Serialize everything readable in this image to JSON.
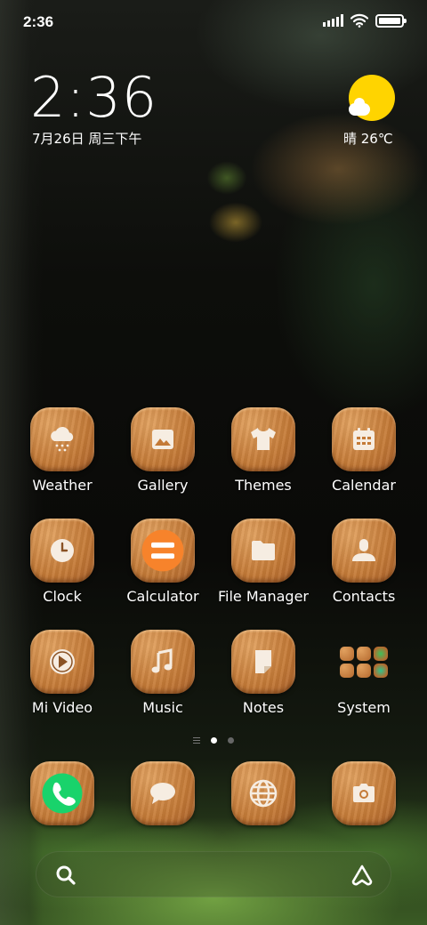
{
  "status_bar": {
    "time": "2:36"
  },
  "clock_widget": {
    "time": "2:36",
    "date": "7月26日 周三下午",
    "weather": "晴 26℃"
  },
  "apps": [
    {
      "label": "Weather",
      "icon": "weather-snow-cloud-icon"
    },
    {
      "label": "Gallery",
      "icon": "gallery-image-icon"
    },
    {
      "label": "Themes",
      "icon": "tshirt-icon"
    },
    {
      "label": "Calendar",
      "icon": "calendar-icon"
    },
    {
      "label": "Clock",
      "icon": "clock-icon"
    },
    {
      "label": "Calculator",
      "icon": "calculator-equals-icon"
    },
    {
      "label": "File Manager",
      "icon": "folder-icon"
    },
    {
      "label": "Contacts",
      "icon": "person-icon"
    },
    {
      "label": "Mi Video",
      "icon": "play-icon"
    },
    {
      "label": "Music",
      "icon": "music-note-icon"
    },
    {
      "label": "Notes",
      "icon": "note-page-icon"
    },
    {
      "label": "System",
      "icon": "folder-grid-icon"
    }
  ],
  "dock": [
    {
      "name": "phone",
      "icon": "phone-icon"
    },
    {
      "name": "messages",
      "icon": "chat-bubble-icon"
    },
    {
      "name": "browser",
      "icon": "globe-icon"
    },
    {
      "name": "camera",
      "icon": "camera-icon"
    }
  ],
  "page_indicator": {
    "pages": 2,
    "active": 0
  },
  "colors": {
    "wood": "#c47a37",
    "weather_sun": "#ffd400",
    "calculator_orange": "#f7832b",
    "phone_green": "#19d36b"
  }
}
